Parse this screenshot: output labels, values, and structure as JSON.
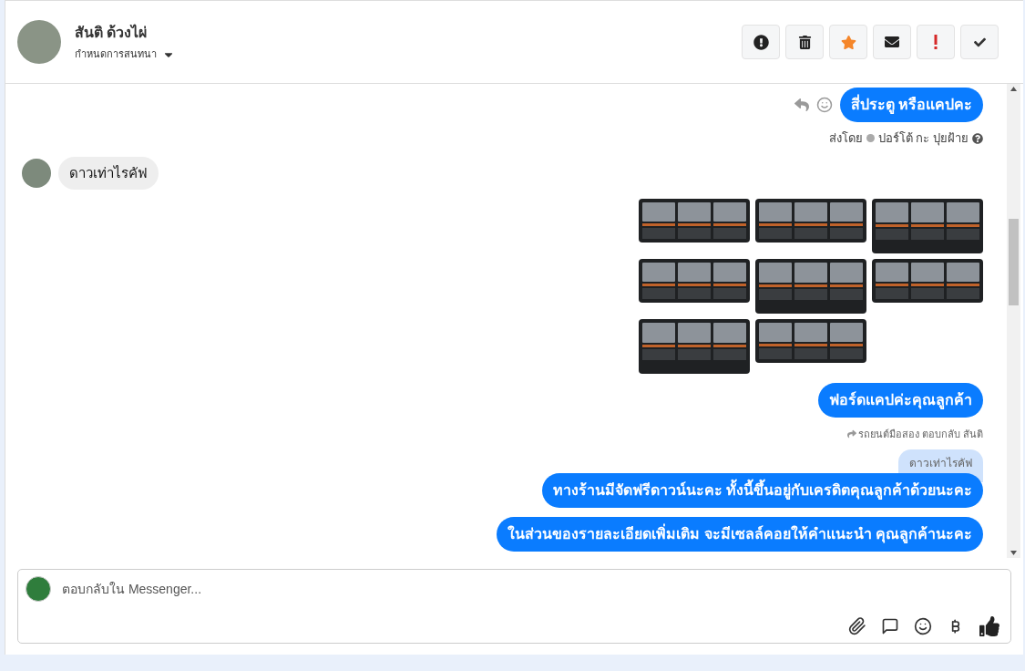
{
  "header": {
    "name": "สันติ ด้วงไผ่",
    "subtitle": "กำหนดการสนทนา",
    "toolbar": [
      {
        "kind": "alert"
      },
      {
        "kind": "delete"
      },
      {
        "kind": "star"
      },
      {
        "kind": "mail"
      },
      {
        "kind": "important"
      },
      {
        "kind": "done"
      }
    ]
  },
  "messages": [
    {
      "kind": "outgoing",
      "text": "สี่ประตู หรือแคปคะ",
      "sender_prefix": "ส่งโดย",
      "sender_name": "ปอร์โต้ กะ ปุยฝ้าย"
    },
    {
      "kind": "incoming",
      "text": "ดาวเท่าไรคัฟ"
    },
    {
      "kind": "images",
      "cards": [
        {
          "tall": false
        },
        {
          "tall": false
        },
        {
          "tall": true
        },
        {
          "tall": false
        },
        {
          "tall": true
        },
        {
          "tall": false
        },
        {
          "tall": true
        },
        {
          "tall": false
        }
      ]
    },
    {
      "kind": "outgoing",
      "text": "ฟอร์ดแคปค่ะคุณลูกค้า"
    },
    {
      "kind": "reply",
      "note": "รถยนต์มือสอง ตอบกลับ สันติ",
      "quote": "ดาวเท่าไรคัฟ",
      "text": "ทางร้านมีจัดฟรีดาวน์นะคะ ทั้งนี้ขึ้นอยู่กับเครดิตคุณลูกค้าด้วยนะคะ"
    },
    {
      "kind": "outgoing",
      "text": "ในส่วนของรายละเอียดเพิ่มเติม จะมีเซลล์คอยให้คำแนะนำ คุณลูกค้านะคะ"
    }
  ],
  "composer": {
    "placeholder": "ตอบกลับใน Messenger...",
    "tools": [
      {
        "kind": "attach"
      },
      {
        "kind": "comment"
      },
      {
        "kind": "emoji"
      },
      {
        "kind": "baht"
      },
      {
        "kind": "like"
      }
    ]
  }
}
